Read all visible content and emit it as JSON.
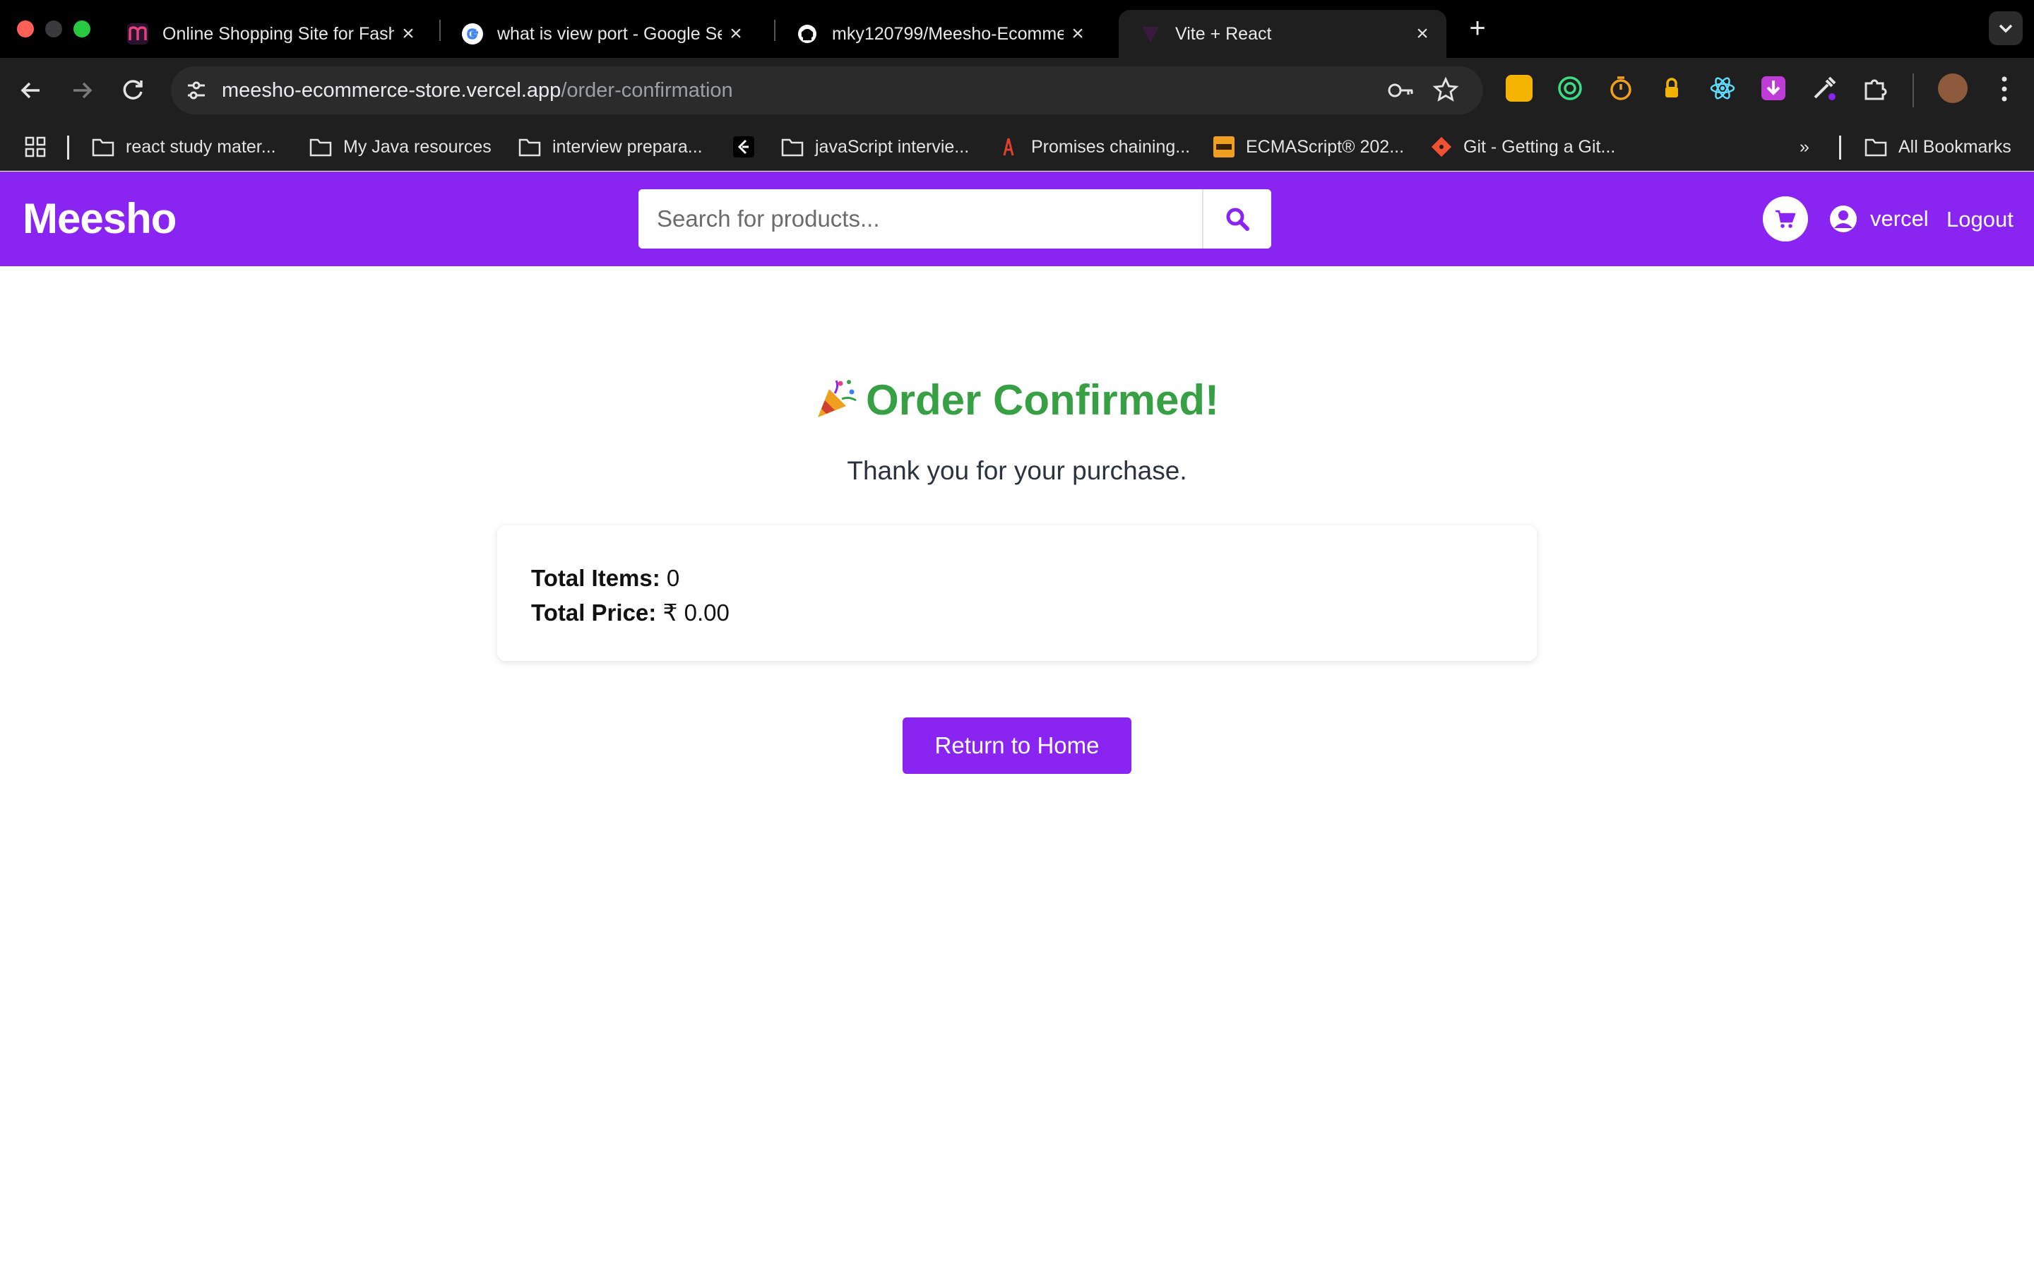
{
  "browser": {
    "tabs": [
      {
        "title": "Online Shopping Site for Fash",
        "favicon": "meesho-m-icon",
        "active": false
      },
      {
        "title": "what is view port - Google Se",
        "favicon": "google-g-icon",
        "active": false
      },
      {
        "title": "mky120799/Meesho-Ecomme",
        "favicon": "github-icon",
        "active": false
      },
      {
        "title": "Vite + React",
        "favicon": "vite-icon",
        "active": true
      }
    ],
    "address": {
      "domain": "meesho-ecommerce-store.vercel.app",
      "path": "/order-confirmation"
    },
    "bookmarks": [
      {
        "label": "react study mater..."
      },
      {
        "label": "My Java resources"
      },
      {
        "label": "interview prepara..."
      },
      {
        "label": "javaScript intervie..."
      },
      {
        "label": "Promises chaining..."
      },
      {
        "label": "ECMAScript® 202..."
      },
      {
        "label": "Git - Getting a Git..."
      },
      {
        "label": "All Bookmarks"
      }
    ],
    "more_bookmarks_glyph": "»"
  },
  "header": {
    "logo": "Meesho",
    "search_placeholder": "Search for products...",
    "username": "vercel",
    "logout_label": "Logout"
  },
  "confirmation": {
    "title": "Order Confirmed!",
    "message": "Thank you for your purchase.",
    "total_items_label": "Total Items:",
    "total_items_value": "0",
    "total_price_label": "Total Price:",
    "total_price_value": "₹ 0.00",
    "return_button": "Return to Home"
  },
  "colors": {
    "brand_purple": "#8a24f2",
    "success_green": "#38a044"
  }
}
